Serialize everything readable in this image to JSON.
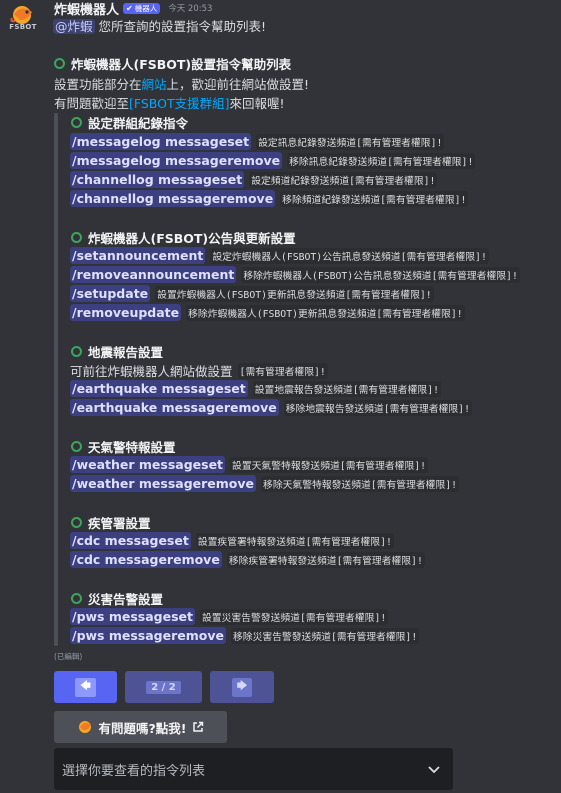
{
  "message": {
    "username": "炸蝦機器人",
    "bot_badge": "機器人",
    "timestamp": "今天 20:53",
    "avatar_text": "FSBOT",
    "reply_mention": "@炸蝦",
    "reply_text": " 您所查詢的設置指令幫助列表!"
  },
  "embed": {
    "title": "炸蝦機器人(FSBOT)設置指令幫助列表",
    "intro1_pre": "設置功能部分在",
    "intro1_link": "網站",
    "intro1_post": "上，歡迎前往網站做設置!",
    "intro2_pre": "有問題歡迎至",
    "intro2_link": "[FSBOT支援群組]",
    "intro2_post": "來回報喔!",
    "sections": [
      {
        "title": "設定群組紀錄指令",
        "commands": [
          {
            "cmd": "/messagelog messageset",
            "desc": "設定訊息紀錄發送頻道[需有管理者權限]!"
          },
          {
            "cmd": "/messagelog messageremove",
            "desc": "移除訊息紀錄發送頻道[需有管理者權限]!"
          },
          {
            "cmd": "/channellog messageset",
            "desc": "設定頻道紀錄發送頻道[需有管理者權限]!"
          },
          {
            "cmd": "/channellog messageremove",
            "desc": "移除頻道紀錄發送頻道[需有管理者權限]!"
          }
        ]
      },
      {
        "title": "炸蝦機器人(FSBOT)公告與更新設置",
        "commands": [
          {
            "cmd": "/setannouncement",
            "desc": "設定炸蝦機器人(FSBOT)公告訊息發送頻道[需有管理者權限]!"
          },
          {
            "cmd": "/removeannouncement",
            "desc": "移除炸蝦機器人(FSBOT)公告訊息發送頻道[需有管理者權限]!"
          },
          {
            "cmd": "/setupdate",
            "desc": "設置炸蝦機器人(FSBOT)更新訊息發送頻道[需有管理者權限]!"
          },
          {
            "cmd": "/removeupdate",
            "desc": "移除炸蝦機器人(FSBOT)更新訊息發送頻道[需有管理者權限]!"
          }
        ]
      },
      {
        "title": "地震報告設置",
        "note_pre": "可前往",
        "note_link": "炸蝦機器人網站",
        "note_post": "做設置",
        "note_code": "[需有管理者權限]!",
        "commands": [
          {
            "cmd": "/earthquake messageset",
            "desc": "設置地震報告發送頻道[需有管理者權限]!"
          },
          {
            "cmd": "/earthquake messageremove",
            "desc": "移除地震報告發送頻道[需有管理者權限]!"
          }
        ]
      },
      {
        "title": "天氣警特報設置",
        "commands": [
          {
            "cmd": "/weather messageset",
            "desc": "設置天氣警特報發送頻道[需有管理者權限]!"
          },
          {
            "cmd": "/weather messageremove",
            "desc": "移除天氣警特報發送頻道[需有管理者權限]!"
          }
        ]
      },
      {
        "title": "疾管署設置",
        "commands": [
          {
            "cmd": "/cdc messageset",
            "desc": "設置疾管署特報發送頻道[需有管理者權限]!"
          },
          {
            "cmd": "/cdc messageremove",
            "desc": "移除疾管署特報發送頻道[需有管理者權限]!"
          }
        ]
      },
      {
        "title": "災害告警設置",
        "commands": [
          {
            "cmd": "/pws messageset",
            "desc": "設置災害告警發送頻道[需有管理者權限]!"
          },
          {
            "cmd": "/pws messageremove",
            "desc": "移除災害告警發送頻道[需有管理者權限]!"
          }
        ]
      }
    ],
    "edited_label": "(已編輯)"
  },
  "buttons": {
    "prev_icon": "arrow-left-icon",
    "page_label": "2 / 2",
    "next_icon": "arrow-right-icon",
    "help_label": "有問題嗎?點我!",
    "help_icon": "external-link-icon"
  },
  "select": {
    "placeholder": "選擇你要查看的指令列表",
    "icon": "chevron-down-icon"
  },
  "colors": {
    "background": "#313338",
    "blurple": "#5865f2",
    "link": "#00a8fc",
    "green_ring": "#3ba55c",
    "command_bg": "#3c3f80"
  }
}
